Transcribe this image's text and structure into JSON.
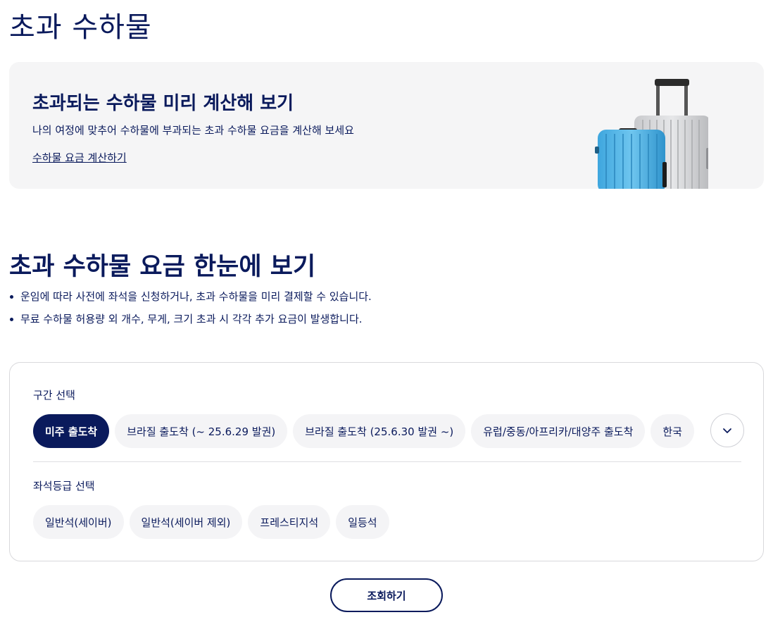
{
  "page": {
    "title": "초과 수하물"
  },
  "calculator_banner": {
    "title": "초과되는 수하물 미리 계산해 보기",
    "description": "나의 여정에 맞추어 수하물에 부과되는 초과 수하물 요금을 계산해 보세요",
    "link_label": "수하물 요금 계산하기"
  },
  "fee_overview": {
    "title": "초과 수하물 요금 한눈에 보기",
    "bullets": [
      "운임에 따라 사전에 좌석을 신청하거나, 초과 수하물을 미리 결제할 수 있습니다.",
      "무료 수하물 허용량 외 개수, 무게, 크기 초과 시 각각 추가 요금이 발생합니다."
    ]
  },
  "filters": {
    "route_label": "구간 선택",
    "routes": [
      "미주 출도착",
      "브라질 출도착 (~ 25.6.29 발권)",
      "브라질 출도착 (25.6.30 발권 ~)",
      "유럽/중동/아프리카/대양주 출도착",
      "한국"
    ],
    "selected_route_index": 0,
    "class_label": "좌석등급 선택",
    "classes": [
      "일반석(세이버)",
      "일반석(세이버 제외)",
      "프레스티지석",
      "일등석"
    ],
    "expand_icon": "chevron-down-icon"
  },
  "actions": {
    "search_label": "조회하기"
  },
  "colors": {
    "navy": "#0a1a5c",
    "chip_bg": "#f4f4f6",
    "banner_bg": "#f5f5f6"
  }
}
